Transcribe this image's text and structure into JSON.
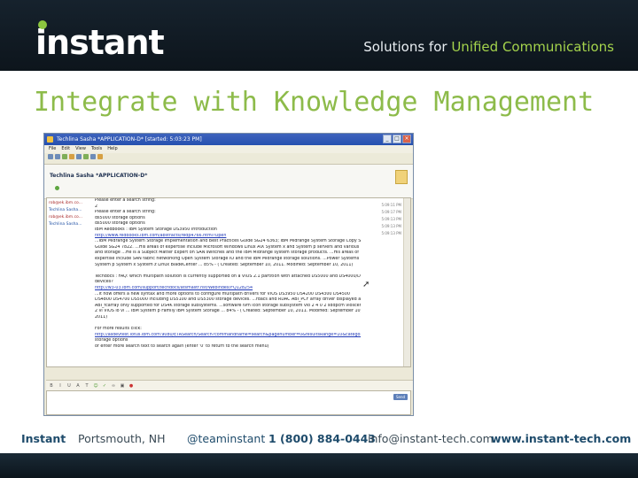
{
  "header": {
    "logo": "instant",
    "tagline_prefix": "Solutions for ",
    "tagline_accent": "Unified Communications"
  },
  "slide": {
    "title": "Integrate with Knowledge Management"
  },
  "window": {
    "title": "Techlina Sasha *APPLICATION-D* [started: 5:03:23 PM]",
    "menu": [
      "File",
      "Edit",
      "View",
      "Tools",
      "Help"
    ],
    "conversation_name": "Techlina Sasha *APPLICATION-D*",
    "senders": [
      "rob@ek.ibm.co...",
      "Techlina Sasha...",
      "rob@ek.ibm.co...",
      "Techlina Sasha..."
    ],
    "times": [
      "5:09:11 PM",
      "5:09:17 PM",
      "5:09:13 PM",
      "5:09:13 PM",
      "5:09:13 PM"
    ],
    "messages": [
      {
        "text": "Please enter a search string:",
        "link": false
      },
      {
        "text": "2",
        "link": false
      },
      {
        "text": "Please enter a search string:",
        "link": false
      },
      {
        "text": "ds5000 storage options",
        "link": false
      },
      {
        "text": "ds5000 storage options",
        "link": false
      },
      {
        "text": "IBM Redbooks : IBM System Storage DS3950 Introduction",
        "link": false
      },
      {
        "text": "http://www.redbooks.ibm.com/abstracts/redp4766.html?Open",
        "link": true
      },
      {
        "text": "...IBM Midrange System Storage Implementation and Best Practices Guide SG24 6363; IBM Midrange System Storage Copy Services",
        "link": false
      },
      {
        "text": "Guide SG24 7822. ...His areas of expertise include Microsoft Windows Linux AIX System x and System p servers and various SAN",
        "link": false
      },
      {
        "text": "and storage ...He is a Subject Matter Expert on SAN switches and the IBM Midrange system storage products. ...His areas of",
        "link": false
      },
      {
        "text": "expertise include SAN fabric networking Open System Storage IO and the IBM Midrange storage solutions. ...Power Systems System i",
        "link": false
      },
      {
        "text": "System p System x System z Linux BladeCenter ... 85% - ( Created: September 10, 2011. Modified: September 10, 2011)",
        "link": false
      },
      {
        "text": "",
        "link": false
      },
      {
        "text": "Techdocs : FAQ: which multipath solution is currently supported on a VIOS 2.1 partition with attached DS5000 and DS4000/DS5000",
        "link": false
      },
      {
        "text": "devices?",
        "link": false
      },
      {
        "text": "http://w3-03.ibm.com/support/techdocs/atsmastr.nsf/WebIndex/FQ128254",
        "link": true
      },
      {
        "text": "...It now offers a new syntax and more options to configure multipath drivers for VIOS DS3950 DS4200 DS4300 DS4500",
        "link": false
      },
      {
        "text": "DS4800 DS4700 DS5000 including DS5100 and DS5300 storage devices. ...rdacs and RDAC ABI_PCF array driver displayed as",
        "link": false
      },
      {
        "text": "ABI_fcarray only supported for DS4K storage subsystems. ...software lvm icon storage subsystem vio 2 4 0 2 sddpcm vioscene 2 4 0",
        "link": false
      },
      {
        "text": "2 vi VIOS io vi ... IBM System p Family IBM System Storage ... 84% - ( Created: September 10, 2011. Modified: September 10,",
        "link": false
      },
      {
        "text": "2011)",
        "link": false
      },
      {
        "text": "",
        "link": false
      },
      {
        "text": "For more results click:",
        "link": false
      },
      {
        "text": "http://asdevtest.lotus.ibm.com:9080/ETASearch/Search?commandname=search&pagenumber=0&resultsRange=10&categories=1336",
        "link": true
      },
      {
        "text": "storage options",
        "link": false
      },
      {
        "text": "or enter more search text to search again (enter '0' to return to the search menu)",
        "link": false
      }
    ],
    "send_label": "Send"
  },
  "footer": {
    "company": "Instant",
    "city": "Portsmouth, NH",
    "twitter": "@teaminstant",
    "phone": "1 (800) 884-0443",
    "email": "info@instant-tech.com",
    "website": "www.instant-tech.com"
  },
  "colors": {
    "header_bg": "#101b24",
    "title_green": "#8dbb4a",
    "accent_green": "#a4d34c",
    "footer_blue": "#1e4b6b"
  }
}
